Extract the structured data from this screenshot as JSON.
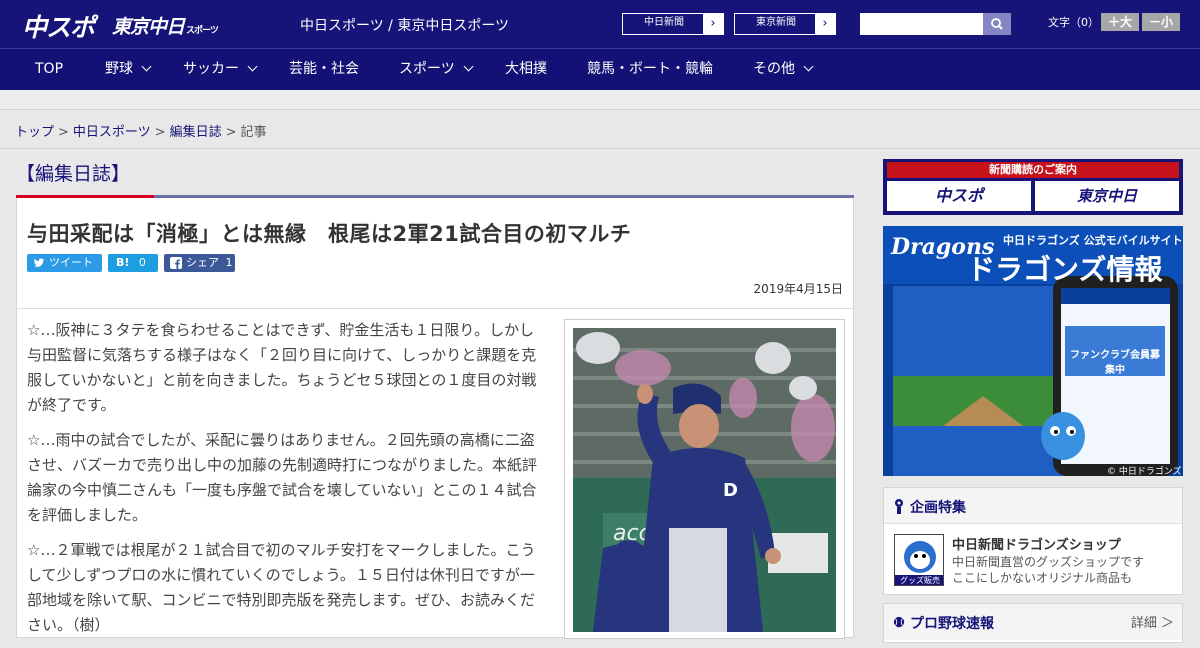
{
  "header": {
    "logo_chunichi": "中スポ",
    "logo_tokyo": "東京中日",
    "logo_tokyo_small": "スポーツ",
    "site_title": "中日スポーツ / 東京中日スポーツ",
    "ext_links": [
      {
        "label": "中日新聞",
        "arrow": "›"
      },
      {
        "label": "東京新聞",
        "arrow": "›"
      }
    ],
    "search_placeholder": "",
    "font_size_label": "文字（0）",
    "font_up": "＋大",
    "font_down": "－小"
  },
  "nav": {
    "items": [
      {
        "label": "TOP"
      },
      {
        "label": "野球"
      },
      {
        "label": "サッカー"
      },
      {
        "label": "芸能・社会"
      },
      {
        "label": "スポーツ"
      },
      {
        "label": "大相撲"
      },
      {
        "label": "競馬・ボート・競輪"
      },
      {
        "label": "その他"
      }
    ]
  },
  "breadcrumb": {
    "items": [
      "トップ",
      "中日スポーツ",
      "編集日誌"
    ],
    "current": "記事",
    "separator": ">"
  },
  "section": {
    "title": "【編集日誌】"
  },
  "article": {
    "headline": "与田采配は「消極」とは無縁　根尾は2軍21試合目の初マルチ",
    "share": {
      "tweet": "ツイート",
      "hatena_label": "B!",
      "hatena_count": "0",
      "facebook": "シェア",
      "facebook_count": "1"
    },
    "date": "2019年4月15日",
    "paragraphs": [
      "☆…阪神に３タテを食らわせることはできず、貯金生活も１日限り。しかし与田監督に気落ちする様子はなく「２回り目に向けて、しっかりと課題を克服していかないと」と前を向きました。ちょうどセ５球団との１度目の対戦が終了です。",
      "☆…雨中の試合でしたが、采配に曇りはありません。２回先頭の高橋に二盗させ、バズーカで売り出し中の加藤の先制適時打につながりました。本紙評論家の今中慎二さんも「一度も序盤で試合を壊していない」とこの１４試合を評価しました。",
      "☆…２軍戦では根尾が２１試合目で初のマルチ安打をマークしました。こうして少しずつプロの水に慣れていくのでしょう。１５日付は休刊日ですが一部地域を除いて駅、コンビニで特別即売版を発売します。ぜひ、お読みください。（樹）"
    ]
  },
  "sidebar": {
    "subscribe": {
      "heading": "新聞購読のご案内",
      "btn_chunichi": "中スポ",
      "btn_tokyo": "東京中日"
    },
    "ad": {
      "brand": "Dragons",
      "line1": "中日ドラゴンズ 公式モバイルサイト",
      "line2": "ドラゴンズ情報",
      "phone_badge": "ファンクラブ会員募集中",
      "copyright": "© 中日ドラゴンズ"
    },
    "feature": {
      "title": "企画特集",
      "shop_title": "中日新聞ドラゴンズショップ",
      "shop_desc1": "中日新聞直営のグッズショップです",
      "shop_desc2": "ここにしかないオリジナル商品も",
      "shop_badge": "グッズ販売中"
    },
    "baseball": {
      "title": "プロ野球速報",
      "more": "詳細 ＞"
    }
  },
  "colors": {
    "header_bg": "#161478",
    "accent_red": "#d7001e",
    "link": "#161478"
  }
}
